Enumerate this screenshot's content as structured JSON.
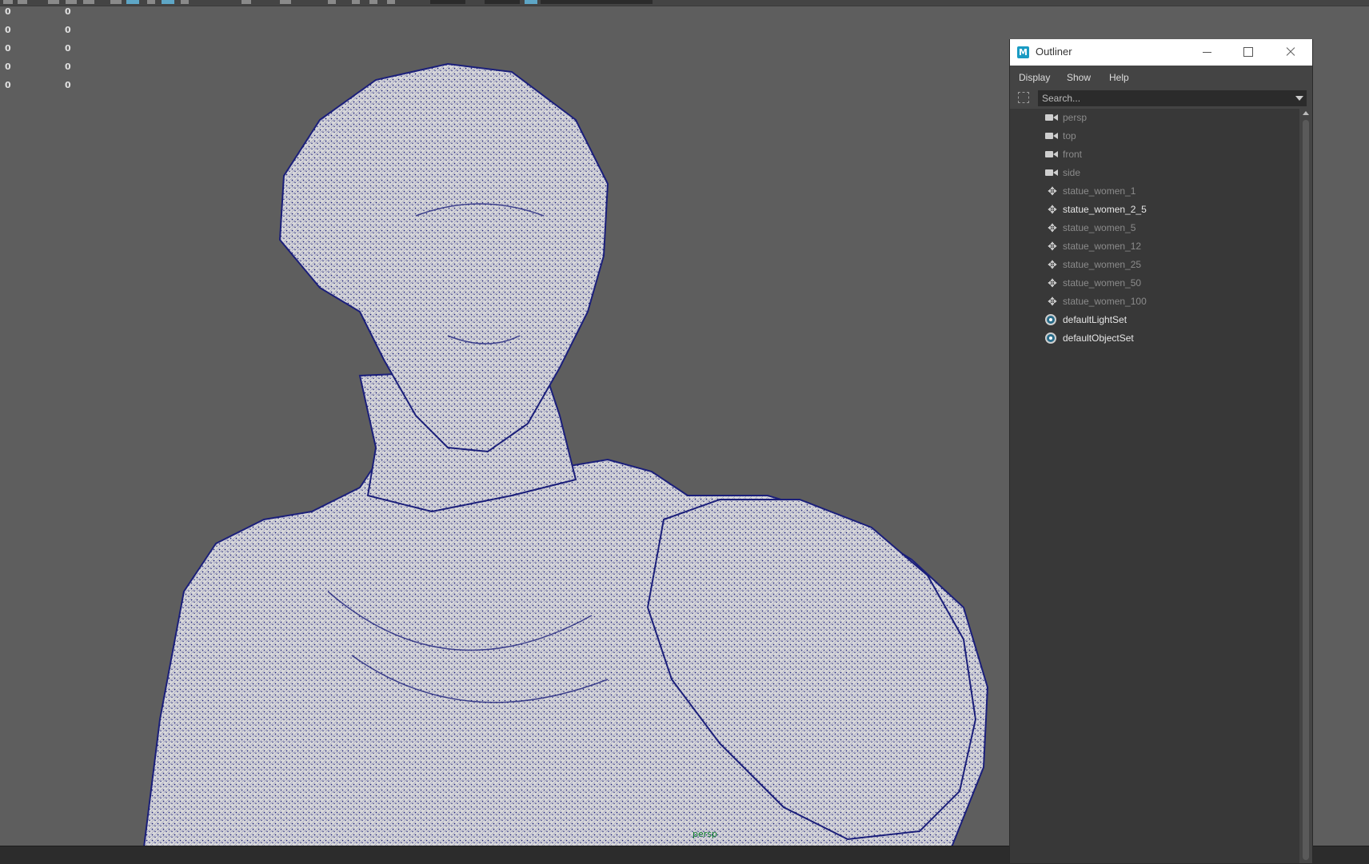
{
  "hud": {
    "rows": [
      {
        "a": "0",
        "b": "0"
      },
      {
        "a": "0",
        "b": "0"
      },
      {
        "a": "0",
        "b": "0"
      },
      {
        "a": "0",
        "b": "0"
      },
      {
        "a": "0",
        "b": "0"
      }
    ]
  },
  "viewport": {
    "camera_label": "persp",
    "wire_color": "#1b1f7a",
    "surface_color": "#d8d8da"
  },
  "outliner": {
    "title": "Outliner",
    "menus": [
      "Display",
      "Show",
      "Help"
    ],
    "search_placeholder": "Search...",
    "items": [
      {
        "label": "persp",
        "icon": "camera-icon",
        "bright": false
      },
      {
        "label": "top",
        "icon": "camera-icon",
        "bright": false
      },
      {
        "label": "front",
        "icon": "camera-icon",
        "bright": false
      },
      {
        "label": "side",
        "icon": "camera-icon",
        "bright": false
      },
      {
        "label": "statue_women_1",
        "icon": "mesh-transform-icon",
        "bright": false
      },
      {
        "label": "statue_women_2_5",
        "icon": "mesh-transform-icon",
        "bright": true
      },
      {
        "label": "statue_women_5",
        "icon": "mesh-transform-icon",
        "bright": false
      },
      {
        "label": "statue_women_12",
        "icon": "mesh-transform-icon",
        "bright": false
      },
      {
        "label": "statue_women_25",
        "icon": "mesh-transform-icon",
        "bright": false
      },
      {
        "label": "statue_women_50",
        "icon": "mesh-transform-icon",
        "bright": false
      },
      {
        "label": "statue_women_100",
        "icon": "mesh-transform-icon",
        "bright": false
      },
      {
        "label": "defaultLightSet",
        "icon": "set-icon",
        "bright": true
      },
      {
        "label": "defaultObjectSet",
        "icon": "set-icon",
        "bright": true
      }
    ]
  }
}
